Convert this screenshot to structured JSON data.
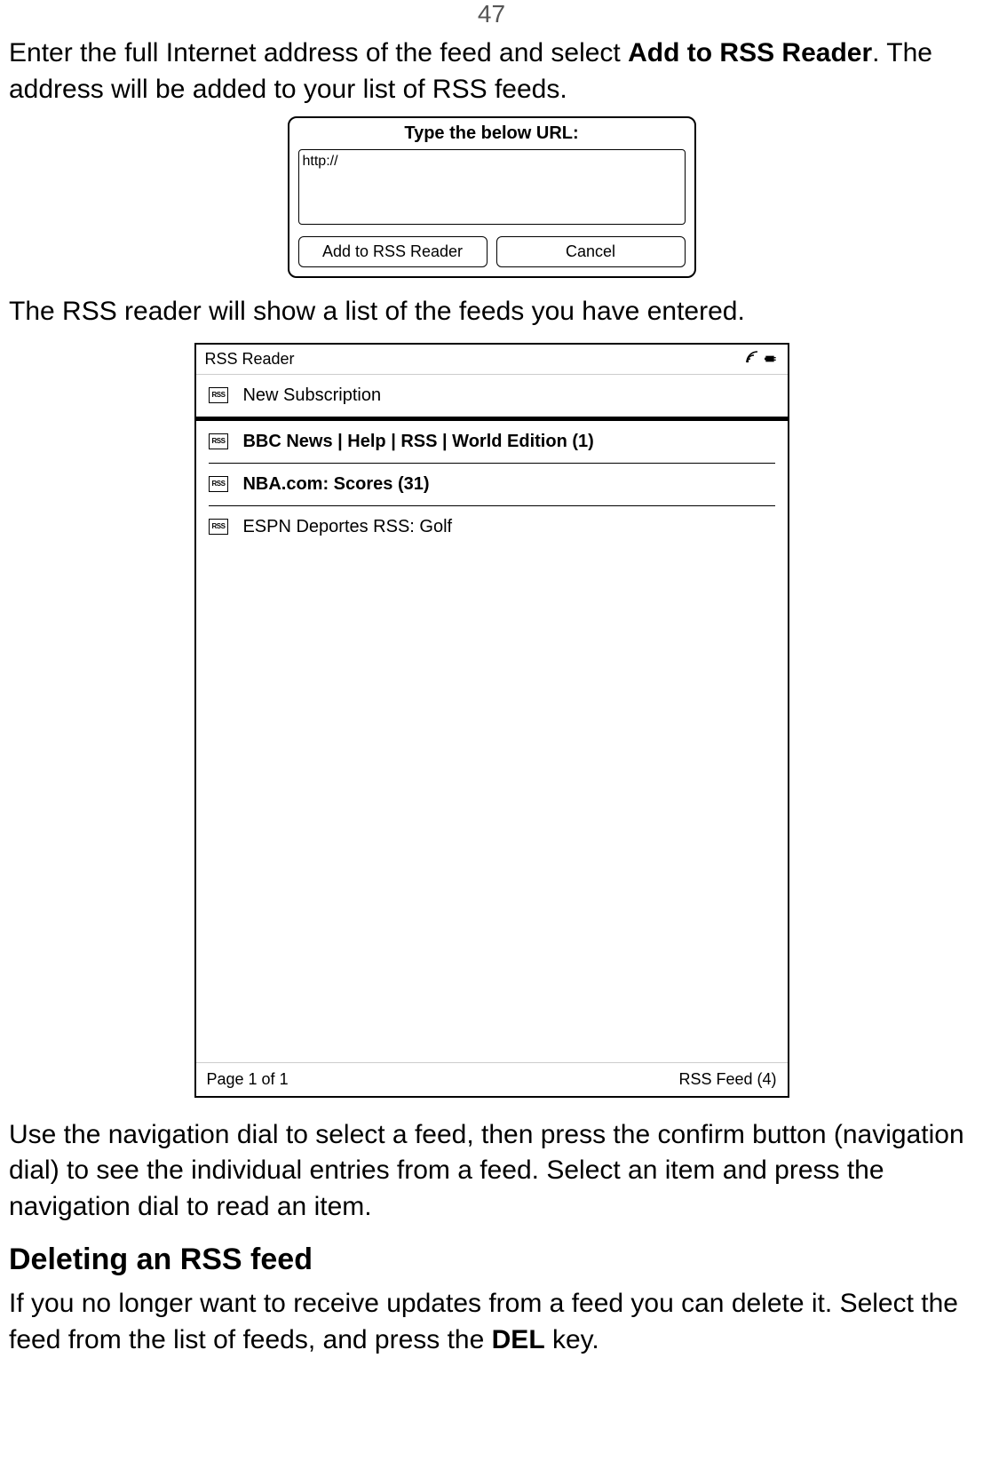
{
  "page_number": "47",
  "intro_text_1": "Enter the full Internet address of the feed and select ",
  "intro_bold_1": "Add to RSS Reader",
  "intro_text_2": ". The address will be added to your list of RSS feeds.",
  "dialog": {
    "title": "Type the below URL:",
    "url_value": "http://",
    "add_button": "Add to RSS Reader",
    "cancel_button": "Cancel"
  },
  "after_dialog_text": "The RSS reader will show a list of the feeds you have entered.",
  "reader": {
    "title": "RSS Reader",
    "rss_badge": "RSS",
    "new_subscription": "New Subscription",
    "feeds": [
      {
        "label": "BBC News | Help | RSS | World Edition (1)",
        "bold": true
      },
      {
        "label": "NBA.com: Scores (31)",
        "bold": true
      },
      {
        "label": "ESPN Deportes RSS: Golf",
        "bold": false
      }
    ],
    "footer_left": "Page 1 of 1",
    "footer_right": "RSS Feed (4)"
  },
  "nav_text": "Use the navigation dial to select a feed, then press the confirm button (navigation dial) to see the individual entries from a feed. Select an item and press the navigation dial to read an item.",
  "deleting_heading": "Deleting an RSS feed",
  "deleting_text_1": "If you no longer want to receive updates from a feed you can delete it. Select the feed from the list of feeds, and press the ",
  "deleting_bold": "DEL",
  "deleting_text_2": " key."
}
